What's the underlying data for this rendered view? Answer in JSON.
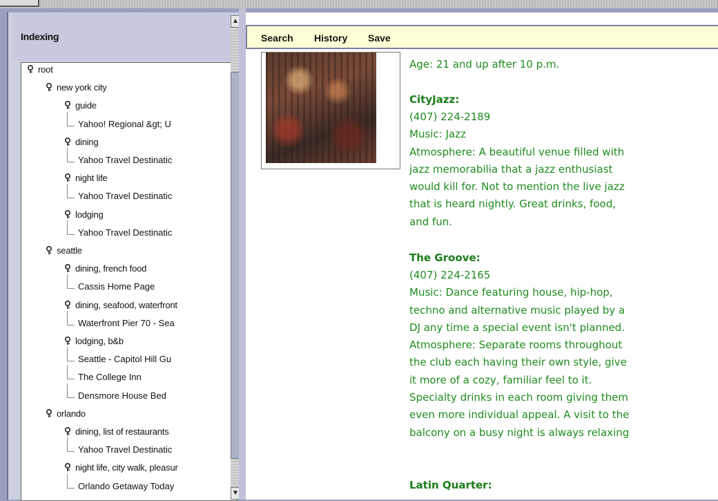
{
  "left_panel": {
    "title": "Indexing",
    "scroll_up": "▲",
    "scroll_down": "▼",
    "tree": [
      {
        "depth": 0,
        "type": "node",
        "label": "root"
      },
      {
        "depth": 1,
        "type": "node",
        "label": "new york city"
      },
      {
        "depth": 2,
        "type": "node",
        "label": "guide"
      },
      {
        "depth": 3,
        "type": "leaf",
        "label": "Yahoo! Regional &gt; U"
      },
      {
        "depth": 2,
        "type": "node",
        "label": "dining"
      },
      {
        "depth": 3,
        "type": "leaf",
        "label": "Yahoo Travel Destinatic"
      },
      {
        "depth": 2,
        "type": "node",
        "label": "night life"
      },
      {
        "depth": 3,
        "type": "leaf",
        "label": "Yahoo Travel Destinatic"
      },
      {
        "depth": 2,
        "type": "node",
        "label": "lodging"
      },
      {
        "depth": 3,
        "type": "leaf",
        "label": "Yahoo Travel Destinatic"
      },
      {
        "depth": 1,
        "type": "node",
        "label": "seattle"
      },
      {
        "depth": 2,
        "type": "node",
        "label": "dining, french food"
      },
      {
        "depth": 3,
        "type": "leaf",
        "label": "Cassis Home Page"
      },
      {
        "depth": 2,
        "type": "node",
        "label": "dining, seafood, waterfront"
      },
      {
        "depth": 3,
        "type": "leaf",
        "label": "Waterfront Pier 70 - Sea"
      },
      {
        "depth": 2,
        "type": "node",
        "label": "lodging, b&b"
      },
      {
        "depth": 3,
        "type": "leaf",
        "label": "Seattle - Capitol Hill Gu"
      },
      {
        "depth": 3,
        "type": "leaf",
        "label": "The College Inn"
      },
      {
        "depth": 3,
        "type": "leaf",
        "label": "Densmore House Bed"
      },
      {
        "depth": 1,
        "type": "node",
        "label": "orlando"
      },
      {
        "depth": 2,
        "type": "node",
        "label": "dining, list of restaurants"
      },
      {
        "depth": 3,
        "type": "leaf",
        "label": "Yahoo Travel Destinatic"
      },
      {
        "depth": 2,
        "type": "node",
        "label": "night life, city walk, pleasur"
      },
      {
        "depth": 3,
        "type": "leaf",
        "label": "Orlando Getaway Today"
      }
    ]
  },
  "toolbar": {
    "search": "Search",
    "history": "History",
    "save": "Save"
  },
  "content": {
    "age_line": "Age: 21 and up after 10 p.m.",
    "cityjazz": {
      "name": "CityJazz:",
      "lines": [
        "(407) 224-2189",
        "Music: Jazz",
        "Atmosphere: A beautiful venue filled with",
        "jazz memorabilia that a jazz enthusiast",
        "would kill for. Not to mention the live jazz",
        "that is heard nightly. Great drinks, food,",
        "and fun."
      ]
    },
    "groove": {
      "name": "The Groove:",
      "lines": [
        "(407) 224-2165",
        "Music: Dance featuring house, hip-hop,",
        "techno and alternative music played by a",
        "DJ any time a special event isn't planned.",
        "Atmosphere: Separate rooms throughout",
        "the club each having their own style, give",
        "it more of a cozy, familiar feel to it.",
        "Specialty drinks in each room giving them",
        "even more individual appeal. A visit to the",
        "balcony on a busy night is always relaxing"
      ]
    },
    "latin": {
      "name": "Latin Quarter:"
    }
  },
  "colors": {
    "text_green": "#1f8b1f",
    "toolbar_bg": "#fefed6",
    "panel_bg": "#9a9fbf"
  }
}
